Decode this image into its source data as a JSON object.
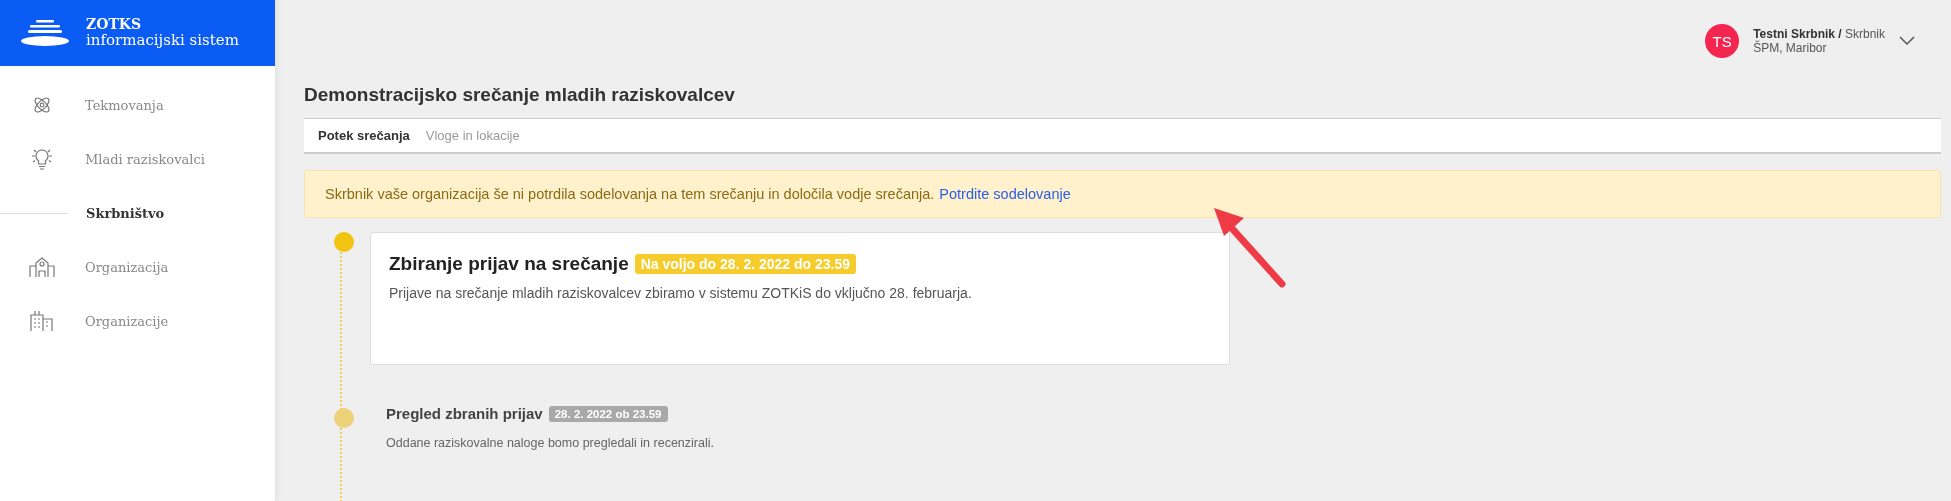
{
  "brand": {
    "name": "ZOTKS",
    "subtitle": "informacijski sistem"
  },
  "sidebar": {
    "items": [
      {
        "label": "Tekmovanja",
        "kind": "link"
      },
      {
        "label": "Mladi raziskovalci",
        "kind": "link"
      },
      {
        "label": "Skrbništvo",
        "kind": "section"
      },
      {
        "label": "Organizacija",
        "kind": "link"
      },
      {
        "label": "Organizacije",
        "kind": "link"
      }
    ]
  },
  "user": {
    "initials": "TS",
    "name": "Testni Skrbnik /",
    "role": "Skrbnik",
    "organization": "ŠPM, Maribor"
  },
  "page_title": "Demonstracijsko srečanje mladih raziskovalcev",
  "tabs": [
    {
      "label": "Potek srečanja",
      "selected": true
    },
    {
      "label": "Vloge in lokacije",
      "selected": false
    }
  ],
  "alert": {
    "text": "Skrbnik vaše organizacija še ni potrdila sodelovanja na tem srečanju in določila vodje srečanja.",
    "link": "Potrdite sodelovanje"
  },
  "timeline": [
    {
      "kind": "active",
      "title": "Zbiranje prijav na srečanje",
      "badge": "Na voljo do 28. 2. 2022 do 23.59",
      "description": "Prijave na srečanje mladih raziskovalcev zbiramo v sistemu ZOTKiS do vključno 28. februarja."
    },
    {
      "kind": "upcoming",
      "title": "Pregled zbranih prijav",
      "badge": "28. 2. 2022 ob 23.59",
      "description": "Oddane raziskovalne naloge bomo pregledali in recenzirali."
    }
  ]
}
